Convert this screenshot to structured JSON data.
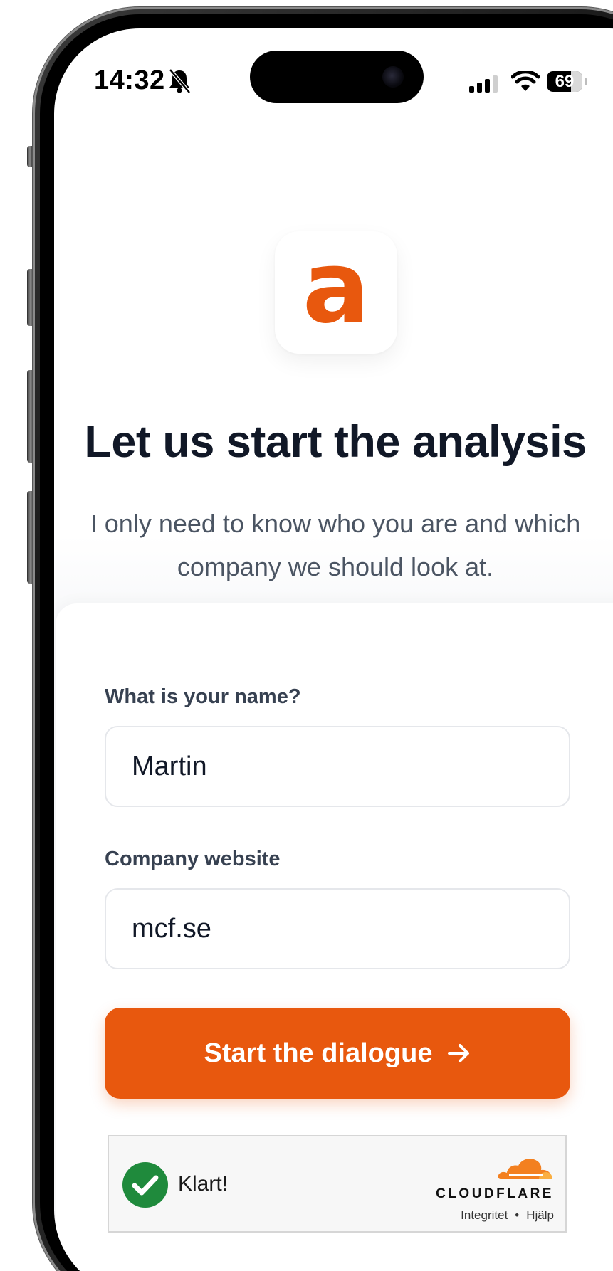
{
  "status_bar": {
    "time": "14:32",
    "battery": "69",
    "icons": [
      "bell-slash-icon",
      "signal-icon",
      "wifi-icon",
      "battery-icon"
    ]
  },
  "header": {
    "logo_letter": "a",
    "title": "Let us start the analysis",
    "subtitle": "I only need to know who you are and which company we should look at."
  },
  "form": {
    "name_label": "What is your name?",
    "name_value": "Martin",
    "website_label": "Company website",
    "website_value": "mcf.se",
    "submit_label": "Start the dialogue",
    "submit_icon": "arrow-right-icon"
  },
  "captcha": {
    "status": "Klart!",
    "brand": "CLOUDFLARE",
    "privacy_link": "Integritet",
    "separator": "•",
    "help_link": "Hjälp"
  },
  "colors": {
    "accent": "#e8580e",
    "title": "#111827",
    "subtitle": "#4b5563",
    "label": "#374151",
    "success": "#1f8a3c",
    "cloudflare_orange": "#f38020"
  }
}
